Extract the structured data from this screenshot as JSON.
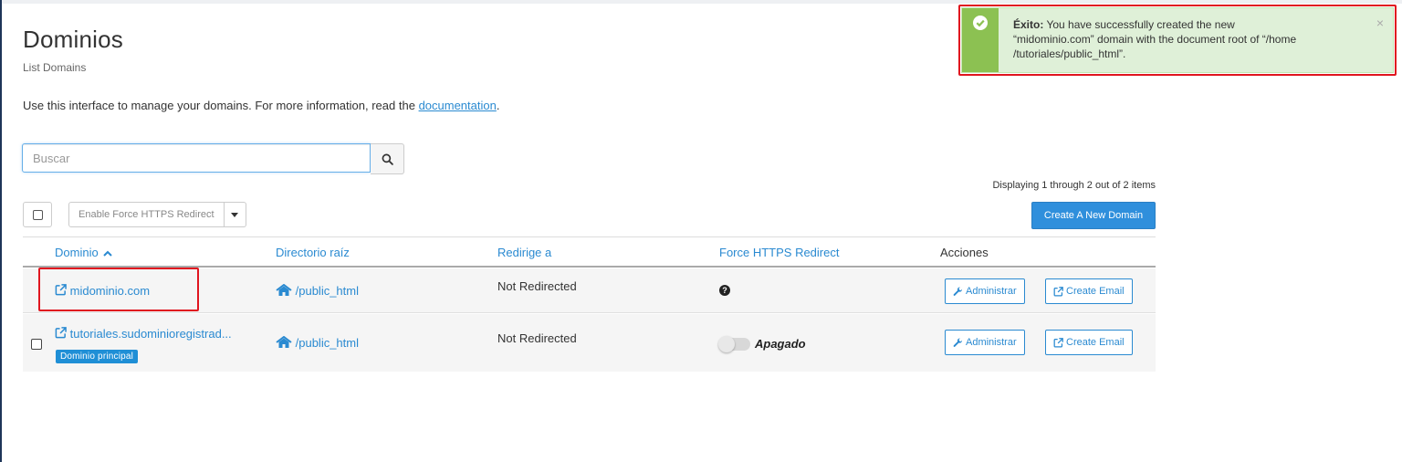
{
  "page": {
    "title": "Dominios",
    "subtitle": "List Domains",
    "description": "Use this interface to manage your domains. For more information, read the",
    "doc_link": "documentation",
    "desc_end": "."
  },
  "search": {
    "placeholder": "Buscar",
    "value": "",
    "icon": "search-icon"
  },
  "toolbar": {
    "bulk_action": "Enable Force HTTPS Redirect",
    "displaying": "Displaying 1 through 2 out of 2 items",
    "create_domain": "Create A New Domain"
  },
  "table": {
    "headers": {
      "domain": "Dominio",
      "docroot": "Directorio raíz",
      "redirect": "Redirige a",
      "https": "Force HTTPS Redirect",
      "actions": "Acciones"
    },
    "sort_indicator": "chevron-up-icon",
    "rows": [
      {
        "domain": "midominio.com",
        "docroot": "/public_html",
        "redirect": "Not Redirected",
        "https_state": "help",
        "manage": "Administrar",
        "create_email": "Create Email"
      },
      {
        "domain": "tutoriales.sudominioregistrad...",
        "badge": "Dominio principal",
        "docroot": "/public_html",
        "redirect": "Not Redirected",
        "https_state": "Apagado",
        "manage": "Administrar",
        "create_email": "Create Email"
      }
    ]
  },
  "alert": {
    "type": "success",
    "label": "Éxito:",
    "message_line1": "You have successfully created the new",
    "message_line2": "“midominio.com” domain with the document root of “/home",
    "message_line3": "/tutoriales/public_html”.",
    "close": "×"
  },
  "colors": {
    "link": "#2a8ad1",
    "primary_button": "#2f8fdc",
    "success_bg": "#dff0d8",
    "success_accent": "#8cc152",
    "highlight": "#e0151f"
  }
}
